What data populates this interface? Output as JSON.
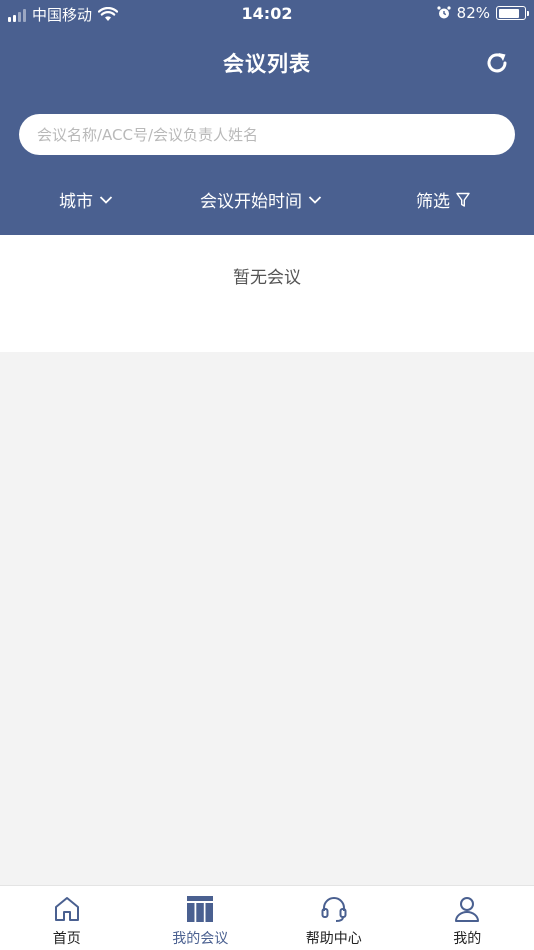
{
  "status_bar": {
    "carrier": "中国移动",
    "time": "14:02",
    "battery": "82%",
    "battery_level": 0.82
  },
  "header": {
    "title": "会议列表",
    "refresh_icon": "refresh-icon"
  },
  "search": {
    "placeholder": "会议名称/ACC号/会议负责人姓名",
    "value": ""
  },
  "filters": [
    {
      "label": "城市",
      "icon": "chevron-down-icon"
    },
    {
      "label": "会议开始时间",
      "icon": "chevron-down-icon"
    },
    {
      "label": "筛选",
      "icon": "filter-icon"
    }
  ],
  "content": {
    "empty_text": "暂无会议"
  },
  "tabbar": {
    "items": [
      {
        "label": "首页",
        "icon": "home-icon",
        "active": false
      },
      {
        "label": "我的会议",
        "icon": "meeting-list-icon",
        "active": true
      },
      {
        "label": "帮助中心",
        "icon": "headset-icon",
        "active": false
      },
      {
        "label": "我的",
        "icon": "user-icon",
        "active": false
      }
    ]
  },
  "colors": {
    "header_bg": "#4a6090",
    "active_tab": "#4a6090",
    "page_bg": "#f3f3f3"
  }
}
